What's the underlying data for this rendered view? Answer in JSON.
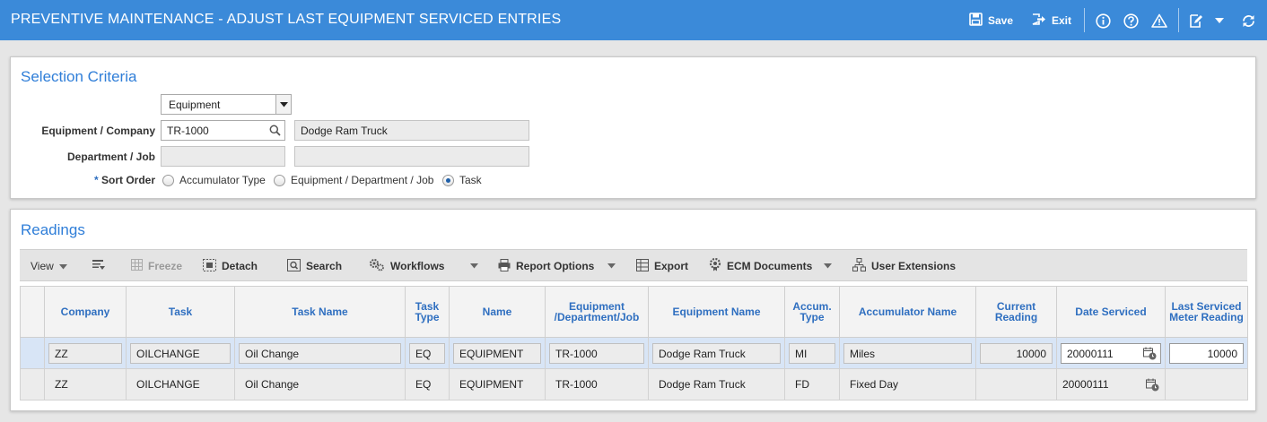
{
  "header": {
    "title": "PREVENTIVE MAINTENANCE - ADJUST LAST EQUIPMENT SERVICED ENTRIES",
    "save_label": "Save",
    "exit_label": "Exit"
  },
  "selection": {
    "title": "Selection Criteria",
    "type_select": "Equipment",
    "equipment_company_label": "Equipment / Company",
    "equipment_value": "TR-1000",
    "equipment_name": "Dodge Ram Truck",
    "department_job_label": "Department / Job",
    "department_value": "",
    "department_name": "",
    "sort_order_required": "*",
    "sort_order_label": "Sort Order",
    "sort_options": [
      "Accumulator Type",
      "Equipment / Department / Job",
      "Task"
    ],
    "sort_selected": "Task"
  },
  "readings": {
    "title": "Readings",
    "toolbar": {
      "view": "View",
      "freeze": "Freeze",
      "detach": "Detach",
      "search": "Search",
      "workflows": "Workflows",
      "report_options": "Report Options",
      "export": "Export",
      "ecm_documents": "ECM Documents",
      "user_extensions": "User Extensions"
    },
    "columns": {
      "company": "Company",
      "task": "Task",
      "task_name": "Task Name",
      "task_type": "Task Type",
      "name": "Name",
      "equipment": "Equipment /Department/Job",
      "equipment_name": "Equipment Name",
      "accum_type": "Accum. Type",
      "accumulator_name": "Accumulator Name",
      "current_reading": "Current Reading",
      "date_serviced": "Date Serviced",
      "last_serviced": "Last Serviced Meter Reading"
    },
    "rows": [
      {
        "company": "ZZ",
        "task": "OILCHANGE",
        "task_name": "Oil Change",
        "task_type": "EQ",
        "name": "EQUIPMENT",
        "equipment": "TR-1000",
        "equipment_name": "Dodge Ram Truck",
        "accum_type": "MI",
        "accumulator_name": "Miles",
        "current_reading": "10000",
        "date_serviced": "20000111",
        "last_serviced": "10000"
      },
      {
        "company": "ZZ",
        "task": "OILCHANGE",
        "task_name": "Oil Change",
        "task_type": "EQ",
        "name": "EQUIPMENT",
        "equipment": "TR-1000",
        "equipment_name": "Dodge Ram Truck",
        "accum_type": "FD",
        "accumulator_name": "Fixed Day",
        "current_reading": "",
        "date_serviced": "20000111",
        "last_serviced": ""
      }
    ]
  },
  "colors": {
    "titlebar": "#3b8ad9",
    "section_title": "#2f7ed8",
    "column_header": "#2f6fc0",
    "selected_row": "#d8e5f6"
  }
}
